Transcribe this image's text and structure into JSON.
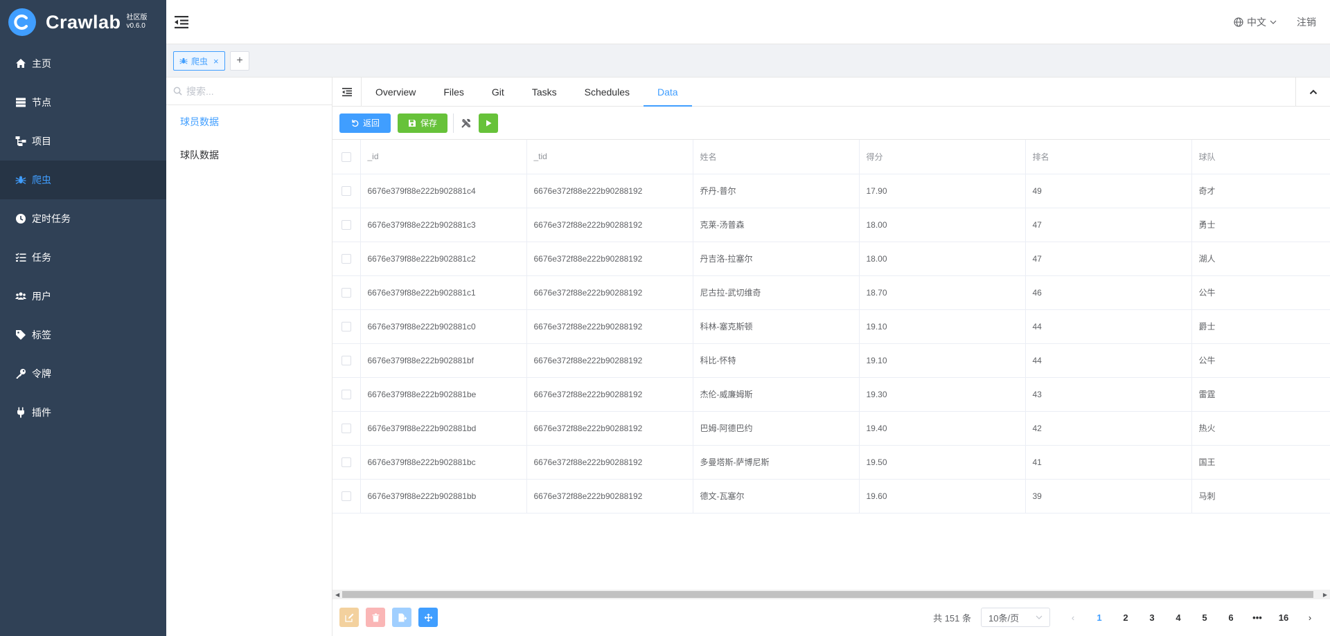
{
  "app": {
    "name": "Crawlab",
    "edition": "社区版",
    "version": "v0.6.0"
  },
  "sidebar": {
    "items": [
      {
        "label": "主页",
        "icon": "home-icon"
      },
      {
        "label": "节点",
        "icon": "server-icon"
      },
      {
        "label": "项目",
        "icon": "project-icon"
      },
      {
        "label": "爬虫",
        "icon": "spider-icon"
      },
      {
        "label": "定时任务",
        "icon": "clock-icon"
      },
      {
        "label": "任务",
        "icon": "task-list-icon"
      },
      {
        "label": "用户",
        "icon": "users-icon"
      },
      {
        "label": "标签",
        "icon": "tag-icon"
      },
      {
        "label": "令牌",
        "icon": "key-icon"
      },
      {
        "label": "插件",
        "icon": "plug-icon"
      }
    ],
    "active_index": 3
  },
  "header": {
    "language": "中文",
    "logout": "注销"
  },
  "page_tabs": {
    "current": "爬虫",
    "add": "+"
  },
  "left_panel": {
    "search_placeholder": "搜索...",
    "collections": [
      "球员数据",
      "球队数据"
    ]
  },
  "nav_tabs": [
    "Overview",
    "Files",
    "Git",
    "Tasks",
    "Schedules",
    "Data"
  ],
  "toolbar": {
    "back": "返回",
    "save": "保存"
  },
  "table": {
    "columns": [
      "_id",
      "_tid",
      "姓名",
      "得分",
      "排名",
      "球队"
    ],
    "rows": [
      [
        "6676e379f88e222b902881c4",
        "6676e372f88e222b90288192",
        "乔丹-普尔",
        "17.90",
        "49",
        "奇才"
      ],
      [
        "6676e379f88e222b902881c3",
        "6676e372f88e222b90288192",
        "克莱-汤普森",
        "18.00",
        "47",
        "勇士"
      ],
      [
        "6676e379f88e222b902881c2",
        "6676e372f88e222b90288192",
        "丹吉洛-拉塞尔",
        "18.00",
        "47",
        "湖人"
      ],
      [
        "6676e379f88e222b902881c1",
        "6676e372f88e222b90288192",
        "尼古拉-武切维奇",
        "18.70",
        "46",
        "公牛"
      ],
      [
        "6676e379f88e222b902881c0",
        "6676e372f88e222b90288192",
        "科林-塞克斯顿",
        "19.10",
        "44",
        "爵士"
      ],
      [
        "6676e379f88e222b902881bf",
        "6676e372f88e222b90288192",
        "科比-怀特",
        "19.10",
        "44",
        "公牛"
      ],
      [
        "6676e379f88e222b902881be",
        "6676e372f88e222b90288192",
        "杰伦-威廉姆斯",
        "19.30",
        "43",
        "雷霆"
      ],
      [
        "6676e379f88e222b902881bd",
        "6676e372f88e222b90288192",
        "巴姆-阿德巴约",
        "19.40",
        "42",
        "热火"
      ],
      [
        "6676e379f88e222b902881bc",
        "6676e372f88e222b90288192",
        "多曼塔斯-萨博尼斯",
        "19.50",
        "41",
        "国王"
      ],
      [
        "6676e379f88e222b902881bb",
        "6676e372f88e222b90288192",
        "德文-瓦塞尔",
        "19.60",
        "39",
        "马刺"
      ]
    ]
  },
  "pagination": {
    "total": "共 151 条",
    "page_size": "10条/页",
    "pages": [
      "1",
      "2",
      "3",
      "4",
      "5",
      "6",
      "•••",
      "16"
    ],
    "current": "1"
  },
  "colors": {
    "sidebar_bg": "#304156",
    "accent": "#409eff",
    "success": "#67c23a"
  }
}
